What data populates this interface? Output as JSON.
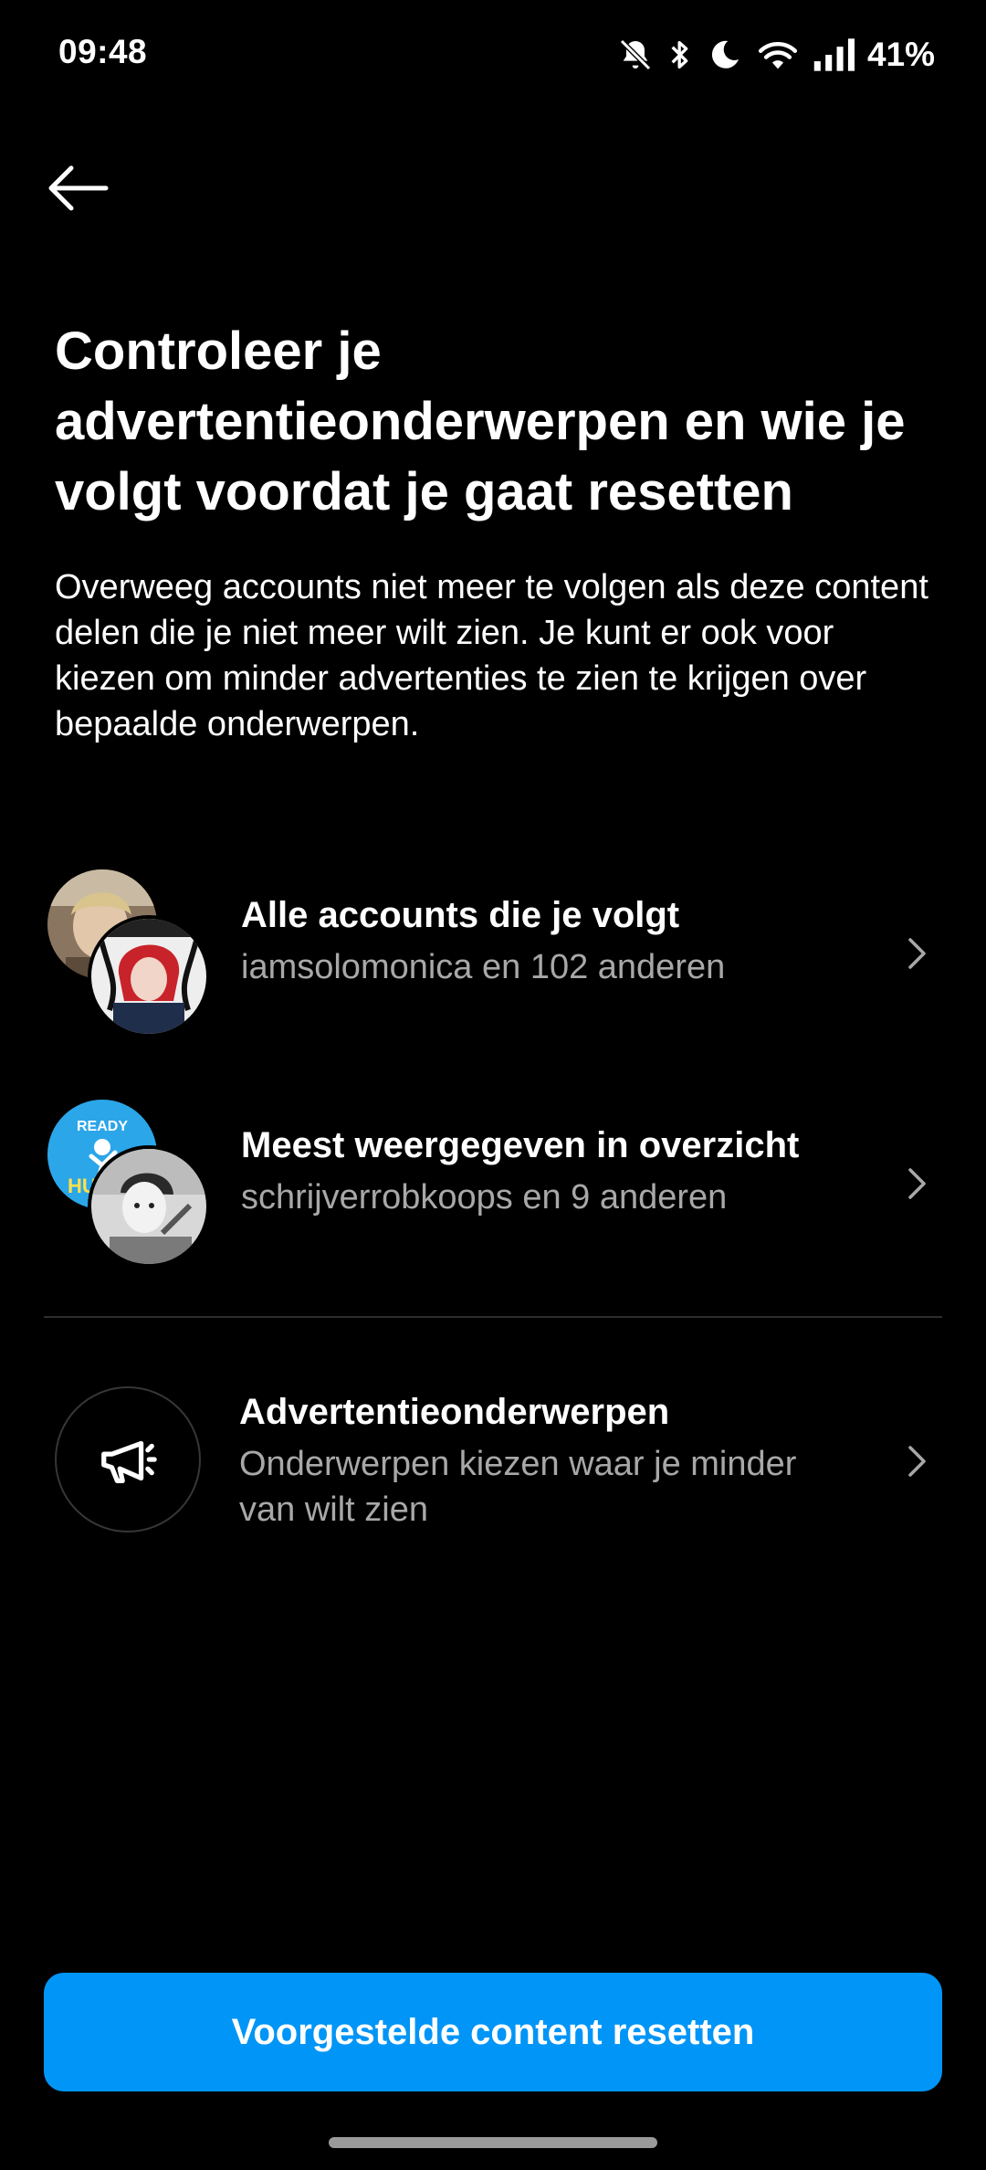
{
  "status_bar": {
    "time": "09:48",
    "battery": "41%",
    "icons": [
      "bell-muted-icon",
      "bluetooth-icon",
      "moon-icon",
      "wifi-icon",
      "signal-icon"
    ]
  },
  "header": {
    "back_icon": "arrow-left-icon"
  },
  "main": {
    "title": "Controleer je advertentieonderwerpen en wie je volgt voordat je gaat resetten",
    "description": "Overweeg accounts niet meer te volgen als deze content delen die je niet meer wilt zien. Je kunt er ook voor kiezen om minder advertenties te zien te krijgen over bepaalde onderwerpen."
  },
  "rows": [
    {
      "title": "Alle accounts die je volgt",
      "subtitle": "iamsolomonica en 102 anderen"
    },
    {
      "title": "Meest weergegeven in overzicht",
      "subtitle": "schrijverrobkoops en 9 anderen",
      "avatar_text_top": "READY",
      "avatar_text_bottom": "HU"
    },
    {
      "title": "Advertentieonderwerpen",
      "subtitle": "Onderwerpen kiezen waar je minder van wilt zien",
      "icon": "megaphone-icon"
    }
  ],
  "footer": {
    "reset_label": "Voorgestelde content resetten"
  },
  "colors": {
    "background": "#000000",
    "primary_button": "#0095f6",
    "secondary_text": "#a8a8a8",
    "divider": "#2e2e2e"
  }
}
